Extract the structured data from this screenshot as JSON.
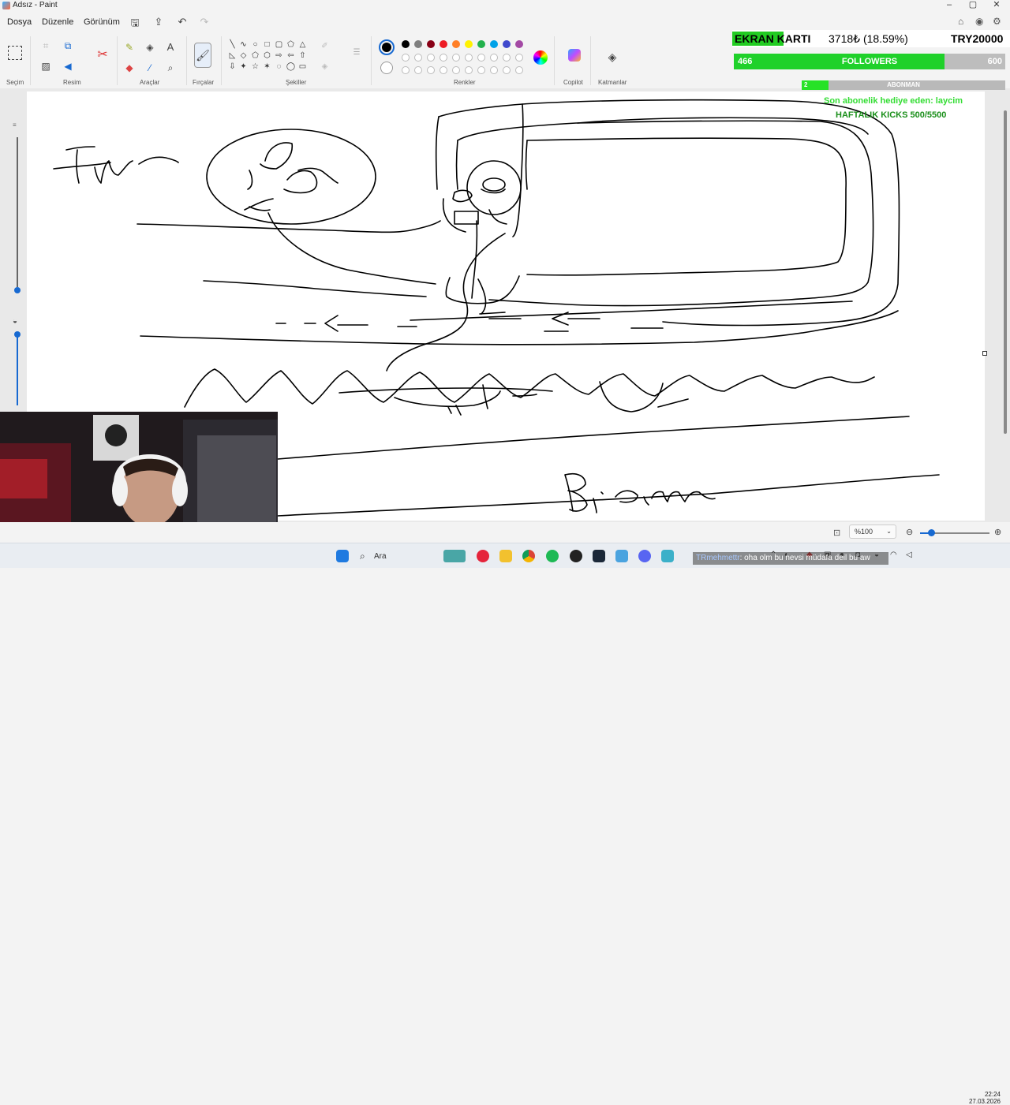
{
  "window": {
    "title": "Adsız - Paint"
  },
  "menu": {
    "items": [
      "Dosya",
      "Düzenle",
      "Görünüm"
    ]
  },
  "ribbon": {
    "groups": [
      "Seçim",
      "Resim",
      "Araçlar",
      "Fırçalar",
      "Şekiller",
      "Renkler",
      "Copilot",
      "Katmanlar"
    ]
  },
  "colors": {
    "palette_row1": [
      "#000000",
      "#7f7f7f",
      "#880015",
      "#ed1c24",
      "#ff7f27",
      "#fff200",
      "#22b14c",
      "#00a2e8",
      "#3f48cc",
      "#a349a4"
    ],
    "palette_row2": [
      "#ffffff",
      "#c3c3c3",
      "#b97a57",
      "#ffaec9",
      "#ffc90e",
      "#efe4b0",
      "#b5e61d",
      "#99d9ea",
      "#7092be",
      "#c8bfe7"
    ],
    "primary": "#000000",
    "accent": "#1769d1"
  },
  "overlay": {
    "ekran_label": "EKRAN KARTI",
    "ekran_amount": "3718₺ (18.59%)",
    "ekran_goal": "TRY20000",
    "ekran_progress": 0.1859,
    "followers_current": "466",
    "followers_label": "FOLLOWERS",
    "followers_max": "600",
    "followers_progress": 0.776,
    "abonman_current": "2",
    "abonman_label": "ABONMAN",
    "abonman_max": "",
    "abonman_progress": 0.13,
    "sub_gift": "Son abonelik hediye eden: laycim",
    "kicks": "HAFTALIK KICKS 500/5500"
  },
  "status": {
    "zoom": "%100"
  },
  "taskbar": {
    "search_placeholder": "Ara",
    "time": "22:24",
    "date": "27.03.2026"
  },
  "chat": {
    "user": "TRmehmettr",
    "message": ": oha olm bu nevsi müdafa deil bu aw"
  }
}
